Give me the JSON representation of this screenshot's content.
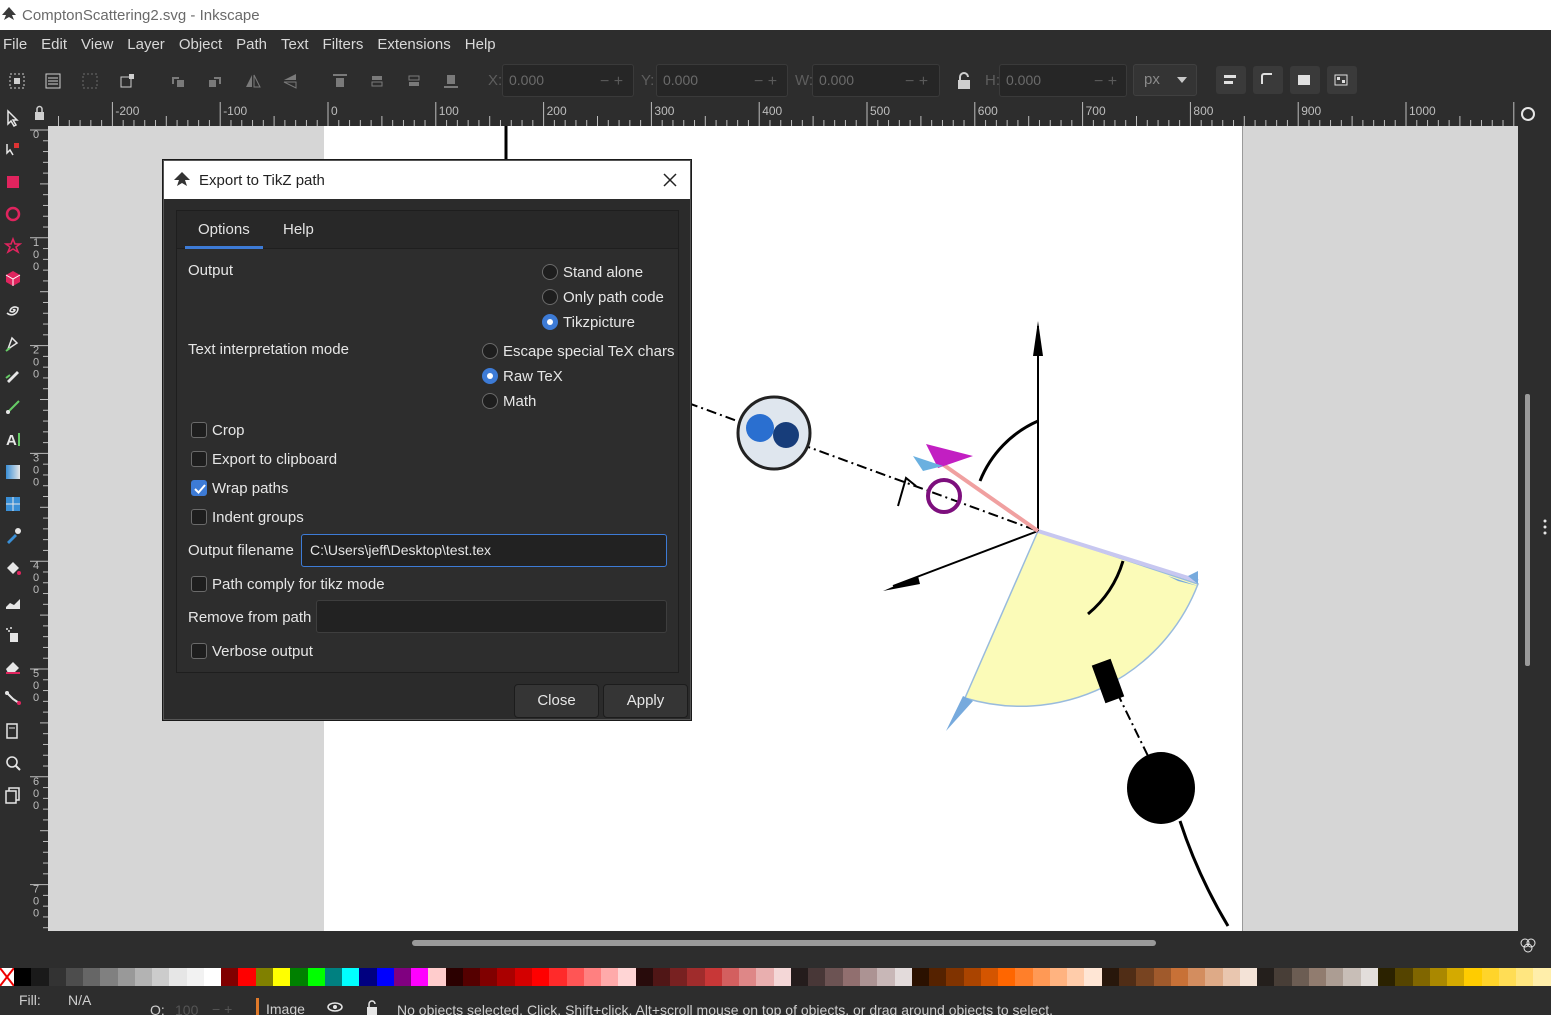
{
  "window": {
    "title": "ComptonScattering2.svg - Inkscape"
  },
  "menubar": {
    "items": [
      "File",
      "Edit",
      "View",
      "Layer",
      "Object",
      "Path",
      "Text",
      "Filters",
      "Extensions",
      "Help"
    ]
  },
  "toolbar": {
    "x_label": "X:",
    "x_value": "0.000",
    "y_label": "Y:",
    "y_value": "0.000",
    "w_label": "W:",
    "w_value": "0.000",
    "h_label": "H:",
    "h_value": "0.000",
    "unit": "px"
  },
  "ruler_top": {
    "labels": [
      "-200",
      "-100",
      "0",
      "100",
      "200",
      "300",
      "400",
      "500",
      "600",
      "700",
      "800",
      "900",
      "1000"
    ]
  },
  "ruler_left": {
    "labels": [
      "0",
      "1",
      "0",
      "0",
      "2",
      "0",
      "0",
      "3",
      "0",
      "0",
      "4",
      "0",
      "0",
      "5",
      "0",
      "0",
      "6",
      "0",
      "0",
      "7",
      "0",
      "0"
    ]
  },
  "dialog": {
    "title": "Export to TikZ path",
    "tabs": [
      {
        "label": "Options",
        "active": true
      },
      {
        "label": "Help",
        "active": false
      }
    ],
    "output": {
      "label": "Output",
      "options": [
        {
          "label": "Stand alone",
          "selected": false
        },
        {
          "label": "Only path code",
          "selected": false
        },
        {
          "label": "Tikzpicture",
          "selected": true
        }
      ]
    },
    "text_mode": {
      "label": "Text interpretation mode",
      "options": [
        {
          "label": "Escape special TeX chars",
          "selected": false
        },
        {
          "label": "Raw TeX",
          "selected": true
        },
        {
          "label": "Math",
          "selected": false
        }
      ]
    },
    "checks": {
      "crop": {
        "label": "Crop",
        "checked": false
      },
      "clipboard": {
        "label": "Export to clipboard",
        "checked": false
      },
      "wrap": {
        "label": "Wrap paths",
        "checked": true
      },
      "indent": {
        "label": "Indent groups",
        "checked": false
      },
      "comply": {
        "label": "Path comply for tikz mode",
        "checked": false
      },
      "verbose": {
        "label": "Verbose output",
        "checked": false
      }
    },
    "output_filename": {
      "label": "Output filename",
      "value": "C:\\Users\\jeff\\Desktop\\test.tex"
    },
    "remove_from_path": {
      "label": "Remove from path",
      "value": ""
    },
    "buttons": {
      "close": "Close",
      "apply": "Apply"
    }
  },
  "statusbar": {
    "fill_label": "Fill:",
    "fill_value": "N/A",
    "opacity_label": "O:",
    "opacity_value": "100",
    "layer": "Image",
    "message": "No objects selected. Click, Shift+click, Alt+scroll mouse on top of objects, or drag around objects to select."
  },
  "palette": {
    "colors": [
      "#000000",
      "#1a1a1a",
      "#333333",
      "#4d4d4d",
      "#666666",
      "#808080",
      "#999999",
      "#b3b3b3",
      "#cccccc",
      "#e6e6e6",
      "#f2f2f2",
      "#ffffff",
      "#800000",
      "#ff0000",
      "#808000",
      "#ffff00",
      "#008000",
      "#00ff00",
      "#008080",
      "#00ffff",
      "#000080",
      "#0000ff",
      "#800080",
      "#ff00ff",
      "#ffcccc",
      "#2b0000",
      "#550000",
      "#800000",
      "#aa0000",
      "#d40000",
      "#ff0000",
      "#ff2a2a",
      "#ff5555",
      "#ff8080",
      "#ffaaaa",
      "#ffd5d5",
      "#280b0b",
      "#501616",
      "#782121",
      "#a02c2c",
      "#c83737",
      "#d35f5f",
      "#de8787",
      "#e9afaf",
      "#f4d7d7",
      "#241c1c",
      "#483737",
      "#6c5353",
      "#916f6f",
      "#ac9393",
      "#c8b7b7",
      "#e3dbdb",
      "#2b1100",
      "#552200",
      "#803300",
      "#aa4400",
      "#d45500",
      "#ff6600",
      "#ff7f2a",
      "#ff9955",
      "#ffb380",
      "#ffccaa",
      "#ffe6d5",
      "#28170b",
      "#502d16",
      "#784421",
      "#a05a2c",
      "#c87137",
      "#d38d5f",
      "#deaa87",
      "#e9c6af",
      "#f4e3d7",
      "#241f1c",
      "#483e37",
      "#6c5d53",
      "#917c6f",
      "#ac9d93",
      "#c8beb7",
      "#e3dedb",
      "#2b2200",
      "#554400",
      "#806600",
      "#aa8800",
      "#d4aa00",
      "#ffcc00",
      "#ffd42a",
      "#ffdd55",
      "#ffe680",
      "#ffeeaa"
    ]
  }
}
